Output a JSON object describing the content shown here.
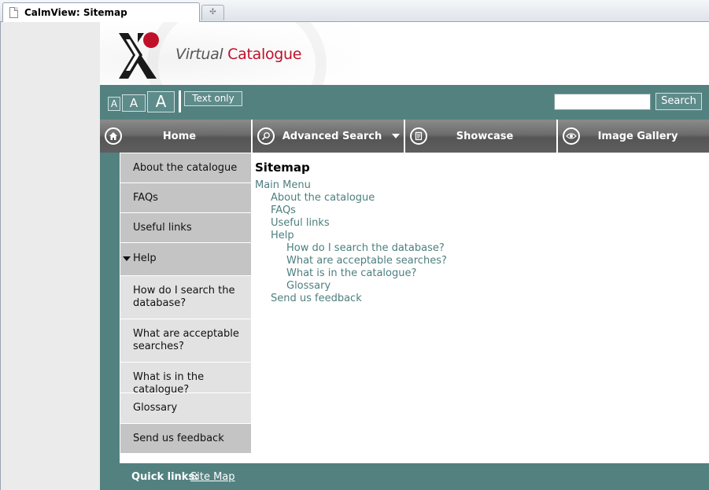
{
  "browser": {
    "tab_title": "CalmView: Sitemap",
    "new_tab_icon": "plus-icon"
  },
  "banner": {
    "title_part1": "Virtual ",
    "title_part2": "Catalogue"
  },
  "toolbar": {
    "font_small": "A",
    "font_medium": "A",
    "font_large": "A",
    "text_only": "Text only",
    "search_value": "",
    "search_button": "Search"
  },
  "nav": {
    "items": [
      {
        "label": "Home",
        "icon": "home-icon"
      },
      {
        "label": "Advanced Search",
        "icon": "magnifier-icon"
      },
      {
        "label": "Showcase",
        "icon": "book-icon"
      },
      {
        "label": "Image Gallery",
        "icon": "eye-icon"
      }
    ]
  },
  "sidebar": {
    "items": [
      "About the catalogue",
      "FAQs",
      "Useful links",
      "Help",
      "How do I search the database?",
      "What are acceptable searches?",
      "What is in the catalogue?",
      "Glossary",
      "Send us feedback"
    ]
  },
  "content": {
    "heading": "Sitemap",
    "sitemap": {
      "root": "Main Menu",
      "about": "About the catalogue",
      "faqs": "FAQs",
      "useful": "Useful links",
      "help": "Help",
      "help_search": "How do I search the database?",
      "help_acceptable": "What are acceptable searches?",
      "help_catalogue": "What is in the catalogue?",
      "help_glossary": "Glossary",
      "feedback": "Send us feedback"
    }
  },
  "footer": {
    "quick_links_label": "Quick links:",
    "site_map": "Site Map"
  },
  "colors": {
    "teal": "#528180",
    "link": "#4d7f7e",
    "brand_red": "#c0102a"
  }
}
